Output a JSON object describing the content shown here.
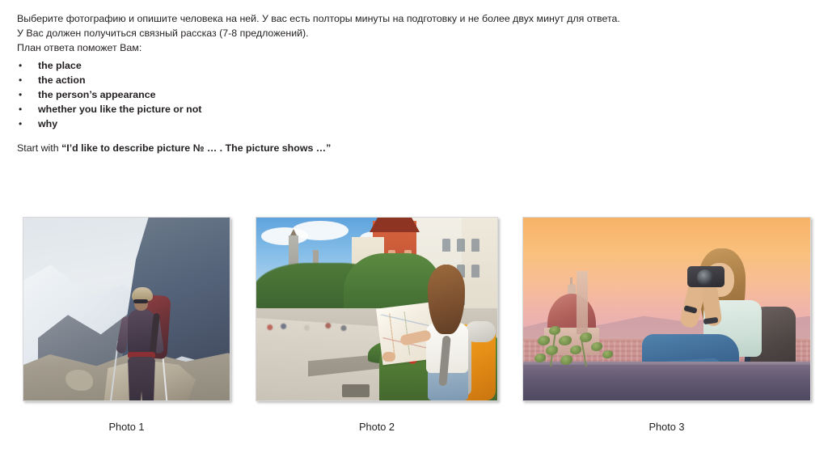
{
  "instructions": {
    "line1": "Выберите фотографию и опишите человека на ней. У вас есть полторы минуты на подготовку и не более двух минут для ответа.",
    "line2": "У Вас должен получиться связный рассказ (7-8 предложений).",
    "line3": "План ответа поможет Вам:",
    "bullet_marker": "•",
    "bullets": [
      {
        "label": "the place"
      },
      {
        "label": "the action"
      },
      {
        "label": "the person’s appearance"
      },
      {
        "label": "whether you like the picture or not"
      },
      {
        "label": "why"
      }
    ],
    "start_prefix": "Start with ",
    "start_quote": "“I’d like to describe picture № … . The picture shows …”"
  },
  "photos": [
    {
      "caption": "Photo 1",
      "alt": "Hiker with trekking poles and a large backpack standing on a rocky ridge in snowy mountains"
    },
    {
      "caption": "Photo 2",
      "alt": "Young woman with a yellow backpack reading a paper map on a European city street"
    },
    {
      "caption": "Photo 3",
      "alt": "Young woman sitting on a stone wall taking a photo with a camera over Florence at sunset"
    }
  ],
  "colors": {
    "text": "#231f20",
    "background": "#ffffff"
  }
}
